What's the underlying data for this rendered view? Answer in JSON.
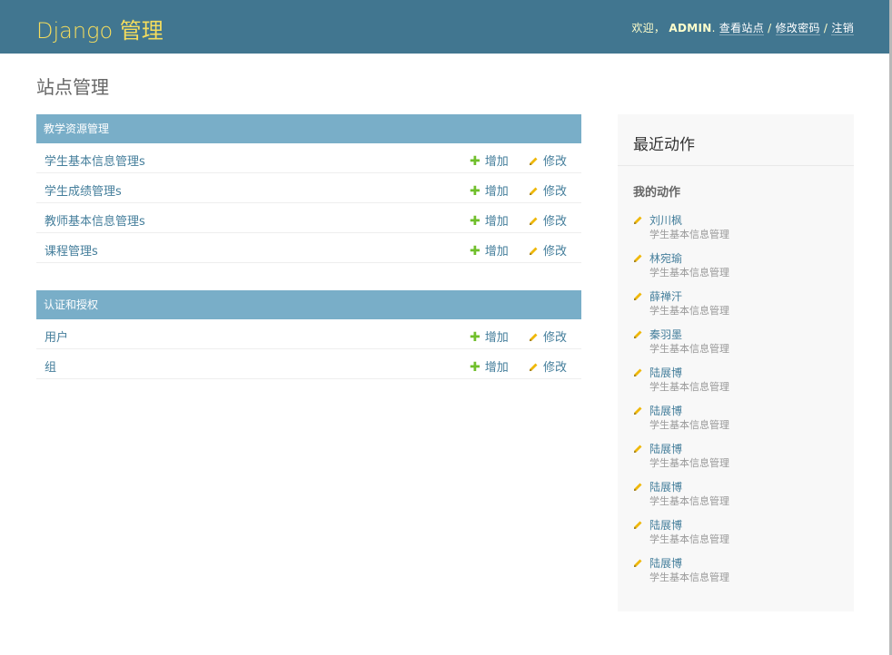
{
  "header": {
    "brand": "Django 管理",
    "welcome": "欢迎，",
    "username": "ADMIN",
    "view_site": "查看站点",
    "change_password": "修改密码",
    "logout": "注销",
    "background_color": "#417690",
    "brand_color": "#f5dd5d"
  },
  "page_title": "站点管理",
  "modules": [
    {
      "caption": "教学资源管理",
      "rows": [
        {
          "name": "学生基本信息管理s",
          "add": "增加",
          "change": "修改"
        },
        {
          "name": "学生成绩管理s",
          "add": "增加",
          "change": "修改"
        },
        {
          "name": "教师基本信息管理s",
          "add": "增加",
          "change": "修改"
        },
        {
          "name": "课程管理s",
          "add": "增加",
          "change": "修改"
        }
      ]
    },
    {
      "caption": "认证和授权",
      "rows": [
        {
          "name": "用户",
          "add": "增加",
          "change": "修改"
        },
        {
          "name": "组",
          "add": "增加",
          "change": "修改"
        }
      ]
    }
  ],
  "sidebar": {
    "title": "最近动作",
    "subtitle": "我的动作",
    "actions": [
      {
        "name": "刘川枫",
        "type": "学生基本信息管理",
        "icon": "pencil-icon"
      },
      {
        "name": "林宛瑜",
        "type": "学生基本信息管理",
        "icon": "pencil-icon"
      },
      {
        "name": "薛禅汗",
        "type": "学生基本信息管理",
        "icon": "pencil-icon"
      },
      {
        "name": "秦羽墨",
        "type": "学生基本信息管理",
        "icon": "pencil-icon"
      },
      {
        "name": "陆展博",
        "type": "学生基本信息管理",
        "icon": "pencil-icon"
      },
      {
        "name": "陆展博",
        "type": "学生基本信息管理",
        "icon": "pencil-icon"
      },
      {
        "name": "陆展博",
        "type": "学生基本信息管理",
        "icon": "pencil-icon"
      },
      {
        "name": "陆展博",
        "type": "学生基本信息管理",
        "icon": "pencil-icon"
      },
      {
        "name": "陆展博",
        "type": "学生基本信息管理",
        "icon": "pencil-icon"
      },
      {
        "name": "陆展博",
        "type": "学生基本信息管理",
        "icon": "pencil-icon"
      }
    ]
  },
  "colors": {
    "caption_bg": "#79aec8",
    "link": "#447e9b",
    "add_icon": "#70bf2b",
    "change_icon": "#efb80b"
  }
}
